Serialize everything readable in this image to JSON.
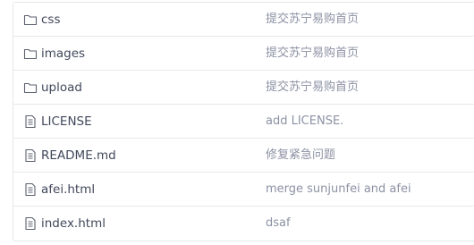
{
  "files": [
    {
      "name": "css",
      "type": "folder",
      "icon": "folder-icon",
      "commit": "提交苏宁易购首页"
    },
    {
      "name": "images",
      "type": "folder",
      "icon": "folder-icon",
      "commit": "提交苏宁易购首页"
    },
    {
      "name": "upload",
      "type": "folder",
      "icon": "folder-icon",
      "commit": "提交苏宁易购首页"
    },
    {
      "name": "LICENSE",
      "type": "file",
      "icon": "file-icon",
      "commit": "add LICENSE."
    },
    {
      "name": "README.md",
      "type": "file",
      "icon": "file-icon",
      "commit": "修复紧急问题"
    },
    {
      "name": "afei.html",
      "type": "file",
      "icon": "file-icon",
      "commit": "merge sunjunfei and afei"
    },
    {
      "name": "index.html",
      "type": "file",
      "icon": "file-icon",
      "commit": "dsaf"
    }
  ],
  "colors": {
    "file_name": "#40485b",
    "commit_message": "#8c92a4",
    "icon_stroke": "#5d6270",
    "row_border": "#e8e8e8"
  }
}
